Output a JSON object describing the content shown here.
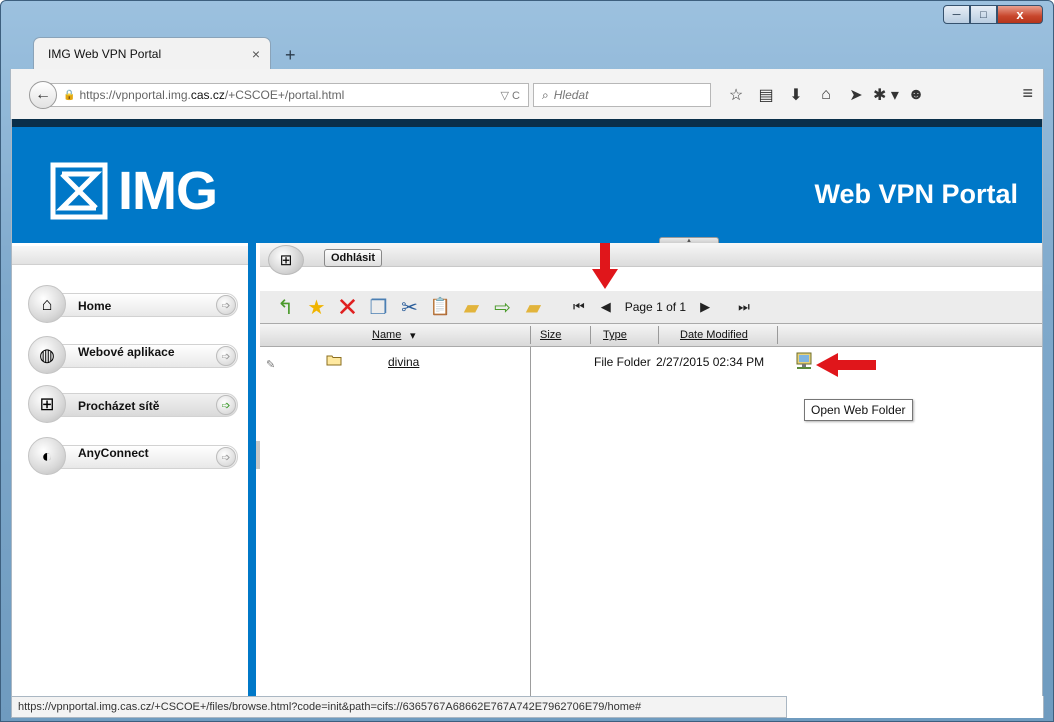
{
  "window": {
    "tab_title": "IMG Web VPN Portal",
    "tab_close": "×",
    "new_tab": "+",
    "minimize": "─",
    "maximize": "□",
    "close": "x"
  },
  "navbar": {
    "back": "←",
    "url_prefix": "https://vpnportal.img.",
    "url_host": "cas.cz",
    "url_path": "/+CSCOE+/portal.html",
    "url_tools": "▽ C",
    "search_placeholder": "Hledat",
    "icons": [
      "☆",
      "▤",
      "⬇",
      "⌂",
      "➤",
      "✱ ▾",
      "☻"
    ],
    "menu": "≡"
  },
  "banner": {
    "logo_text": "IMG",
    "portal_title": "Web VPN Portal",
    "collapse": "▲"
  },
  "sidebar": {
    "items": [
      {
        "label": "Home",
        "icon": "⌂",
        "active": false
      },
      {
        "label": "Webové aplikace",
        "icon": "◍",
        "active": false
      },
      {
        "label": "Procházet sítě",
        "icon": "⊞",
        "active": true
      },
      {
        "label": "AnyConnect",
        "icon": "◐",
        "active": false
      }
    ],
    "arrow": "➩"
  },
  "browser": {
    "logout_label": "Odhlásit",
    "net_icon": "⊞",
    "toolbar_icons": {
      "up": "↰",
      "favorite": "★",
      "delete": "✕",
      "copy": "❐",
      "cut": "✂",
      "paste": "📋",
      "new_folder": "▰",
      "upload": "⇨",
      "open_folder": "▰"
    },
    "pager": {
      "first": "⏮",
      "prev": "◀",
      "label": "Page 1 of 1",
      "next": "▶",
      "last": "⏭"
    },
    "columns": {
      "name": "Name",
      "sort": "▾",
      "size": "Size",
      "type": "Type",
      "date": "Date Modified"
    },
    "rows": [
      {
        "name": "divina",
        "size": "",
        "type": "File Folder",
        "date": "2/27/2015 02:34 PM"
      }
    ],
    "tooltip": "Open Web Folder"
  },
  "status_bar": {
    "text": "https://vpnportal.img.cas.cz/+CSCOE+/files/browse.html?code=init&path=cifs://6365767A68662E767A742E7962706E79/home#"
  },
  "colors": {
    "banner": "#0078c8",
    "topline": "#0a2f4a",
    "annotation_arrow": "#e0161b",
    "favorite": "#f0b400",
    "delete": "#e02020"
  }
}
